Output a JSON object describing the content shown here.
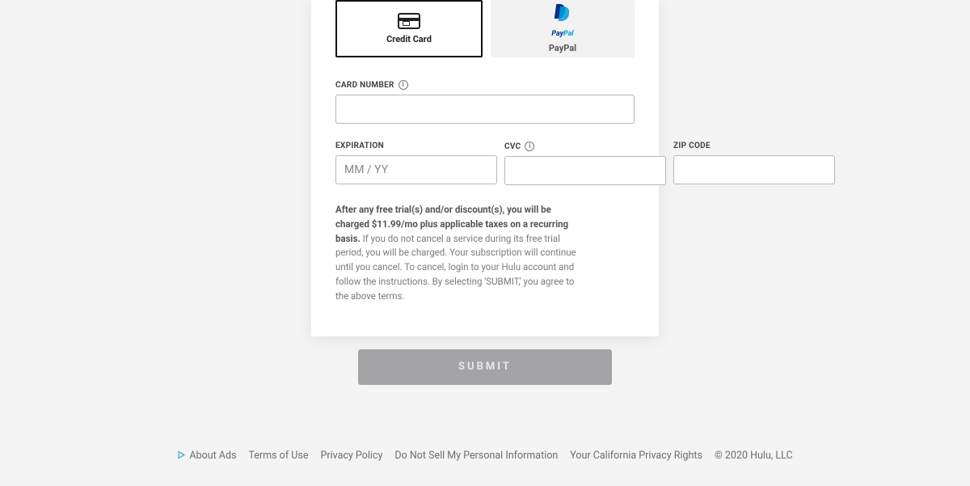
{
  "payment_methods": {
    "credit_card": {
      "label": "Credit Card"
    },
    "paypal": {
      "label": "PayPal",
      "logo_text_1": "Pay",
      "logo_text_2": "Pal"
    }
  },
  "fields": {
    "card_number": {
      "label": "CARD NUMBER"
    },
    "expiration": {
      "label": "EXPIRATION",
      "placeholder": "MM / YY"
    },
    "cvc": {
      "label": "CVC"
    },
    "zip": {
      "label": "ZIP CODE"
    }
  },
  "disclosure": {
    "bold": "After any free trial(s) and/or discount(s), you will be charged $11.99/mo plus applicable taxes on a recurring basis.",
    "rest": " If you do not cancel a service during its free trial period, you will be charged. Your subscription will continue until you cancel. To cancel, login to your Hulu account and follow the instructions. By selecting 'SUBMIT,' you agree to the above terms."
  },
  "submit": {
    "label": "SUBMIT"
  },
  "footer": {
    "about_ads": "About Ads",
    "terms": "Terms of Use",
    "privacy": "Privacy Policy",
    "do_not_sell": "Do Not Sell My Personal Information",
    "ca_rights": "Your California Privacy Rights",
    "copyright": "© 2020 Hulu, LLC"
  }
}
